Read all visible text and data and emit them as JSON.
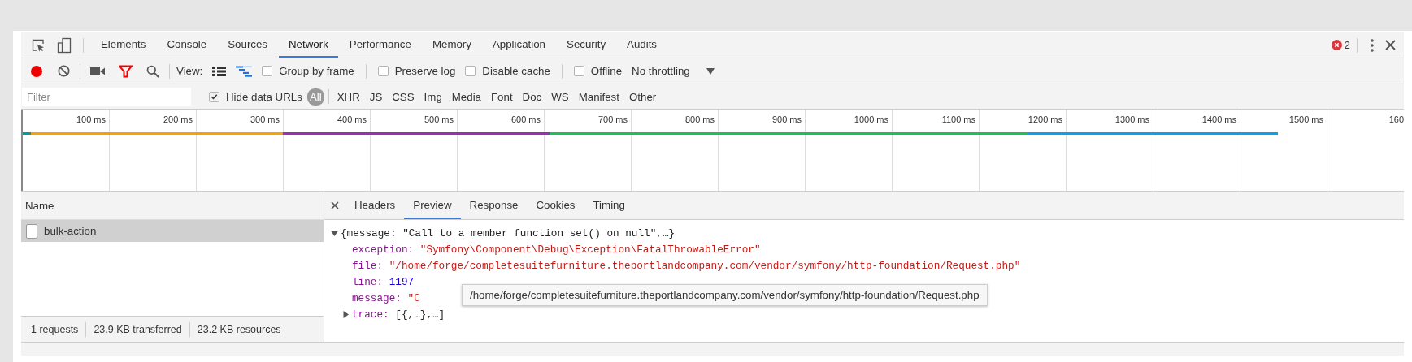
{
  "main_tabs": [
    {
      "label": "Elements",
      "selected": false
    },
    {
      "label": "Console",
      "selected": false
    },
    {
      "label": "Sources",
      "selected": false
    },
    {
      "label": "Network",
      "selected": true
    },
    {
      "label": "Performance",
      "selected": false
    },
    {
      "label": "Memory",
      "selected": false
    },
    {
      "label": "Application",
      "selected": false
    },
    {
      "label": "Security",
      "selected": false
    },
    {
      "label": "Audits",
      "selected": false
    }
  ],
  "error_count": "2",
  "toolbar": {
    "recording": true,
    "filter_on": true,
    "view_label": "View:",
    "view_toggles": [
      {
        "kind": "large-rows",
        "on": false
      },
      {
        "kind": "overview",
        "on": true
      }
    ],
    "options": [
      {
        "label": "Group by frame",
        "checked": false,
        "separator_after": true
      },
      {
        "label": "Preserve log",
        "checked": false,
        "separator_after": false
      },
      {
        "label": "Disable cache",
        "checked": false,
        "separator_after": true
      },
      {
        "label": "Offline",
        "checked": false,
        "separator_after": false
      }
    ],
    "throttling": "No throttling"
  },
  "filter_bar": {
    "placeholder": "Filter",
    "hide_data_urls": {
      "label": "Hide data URLs",
      "checked": true
    },
    "types": [
      {
        "label": "All",
        "selected": true
      },
      {
        "label": "XHR",
        "selected": false
      },
      {
        "label": "JS",
        "selected": false
      },
      {
        "label": "CSS",
        "selected": false
      },
      {
        "label": "Img",
        "selected": false
      },
      {
        "label": "Media",
        "selected": false
      },
      {
        "label": "Font",
        "selected": false
      },
      {
        "label": "Doc",
        "selected": false
      },
      {
        "label": "WS",
        "selected": false
      },
      {
        "label": "Manifest",
        "selected": false
      },
      {
        "label": "Other",
        "selected": false
      }
    ]
  },
  "timeline": {
    "ticks": [
      "100 ms",
      "200 ms",
      "300 ms",
      "400 ms",
      "500 ms",
      "600 ms",
      "700 ms",
      "800 ms",
      "900 ms",
      "1000 ms",
      "1100 ms",
      "1200 ms",
      "1300 ms",
      "1400 ms",
      "1500 ms",
      "160"
    ]
  },
  "requests": {
    "column": "Name",
    "rows": [
      {
        "name": "bulk-action",
        "selected": true
      }
    ]
  },
  "status_bar": [
    "1 requests",
    "23.9 KB transferred",
    "23.2 KB resources"
  ],
  "detail_tabs": [
    {
      "label": "Headers",
      "selected": false
    },
    {
      "label": "Preview",
      "selected": true
    },
    {
      "label": "Response",
      "selected": false
    },
    {
      "label": "Cookies",
      "selected": false
    },
    {
      "label": "Timing",
      "selected": false
    }
  ],
  "preview": {
    "summary": "{message: \"Call to a member function set() on null\",…}",
    "expanded": true,
    "properties": [
      {
        "key": "exception:",
        "value": "\"Symfony\\Component\\Debug\\Exception\\FatalThrowableError\"",
        "kind": "string"
      },
      {
        "key": "file:",
        "value": "\"/home/forge/completesuitefurniture.theportlandcompany.com/vendor/symfony/http-foundation/Request.php\"",
        "kind": "string"
      },
      {
        "key": "line:",
        "value": "1197",
        "kind": "number"
      },
      {
        "key": "message:",
        "value": "\"C",
        "kind": "string"
      },
      {
        "key": "trace:",
        "value": "[{,…},…]",
        "kind": "array",
        "expanded": false
      }
    ]
  },
  "tooltip": "/home/forge/completesuitefurniture.theportlandcompany.com/vendor/symfony/http-foundation/Request.php"
}
